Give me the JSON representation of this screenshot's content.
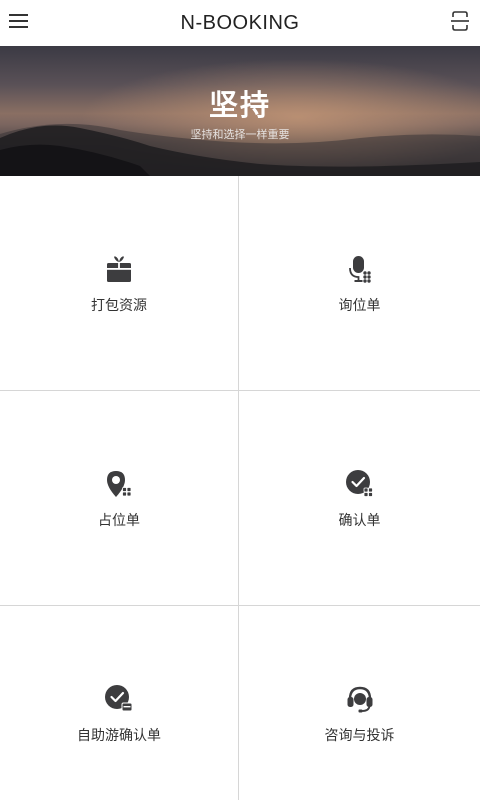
{
  "header": {
    "title": "N-BOOKING",
    "menu_icon": "hamburger-menu-icon",
    "scan_icon": "scan-icon"
  },
  "banner": {
    "title": "坚持",
    "subtitle": "坚持和选择一样重要"
  },
  "tiles": [
    {
      "label": "打包资源",
      "icon": "gift-box-icon"
    },
    {
      "label": "询位单",
      "icon": "microphone-grid-icon"
    },
    {
      "label": "占位单",
      "icon": "location-pin-grid-icon"
    },
    {
      "label": "确认单",
      "icon": "check-circle-grid-icon"
    },
    {
      "label": "自助游确认单",
      "icon": "check-circle-card-icon"
    },
    {
      "label": "咨询与投诉",
      "icon": "headset-icon"
    }
  ],
  "colors": {
    "icon": "#3d3d3f",
    "divider": "#d6d6d6",
    "text": "#333333"
  }
}
